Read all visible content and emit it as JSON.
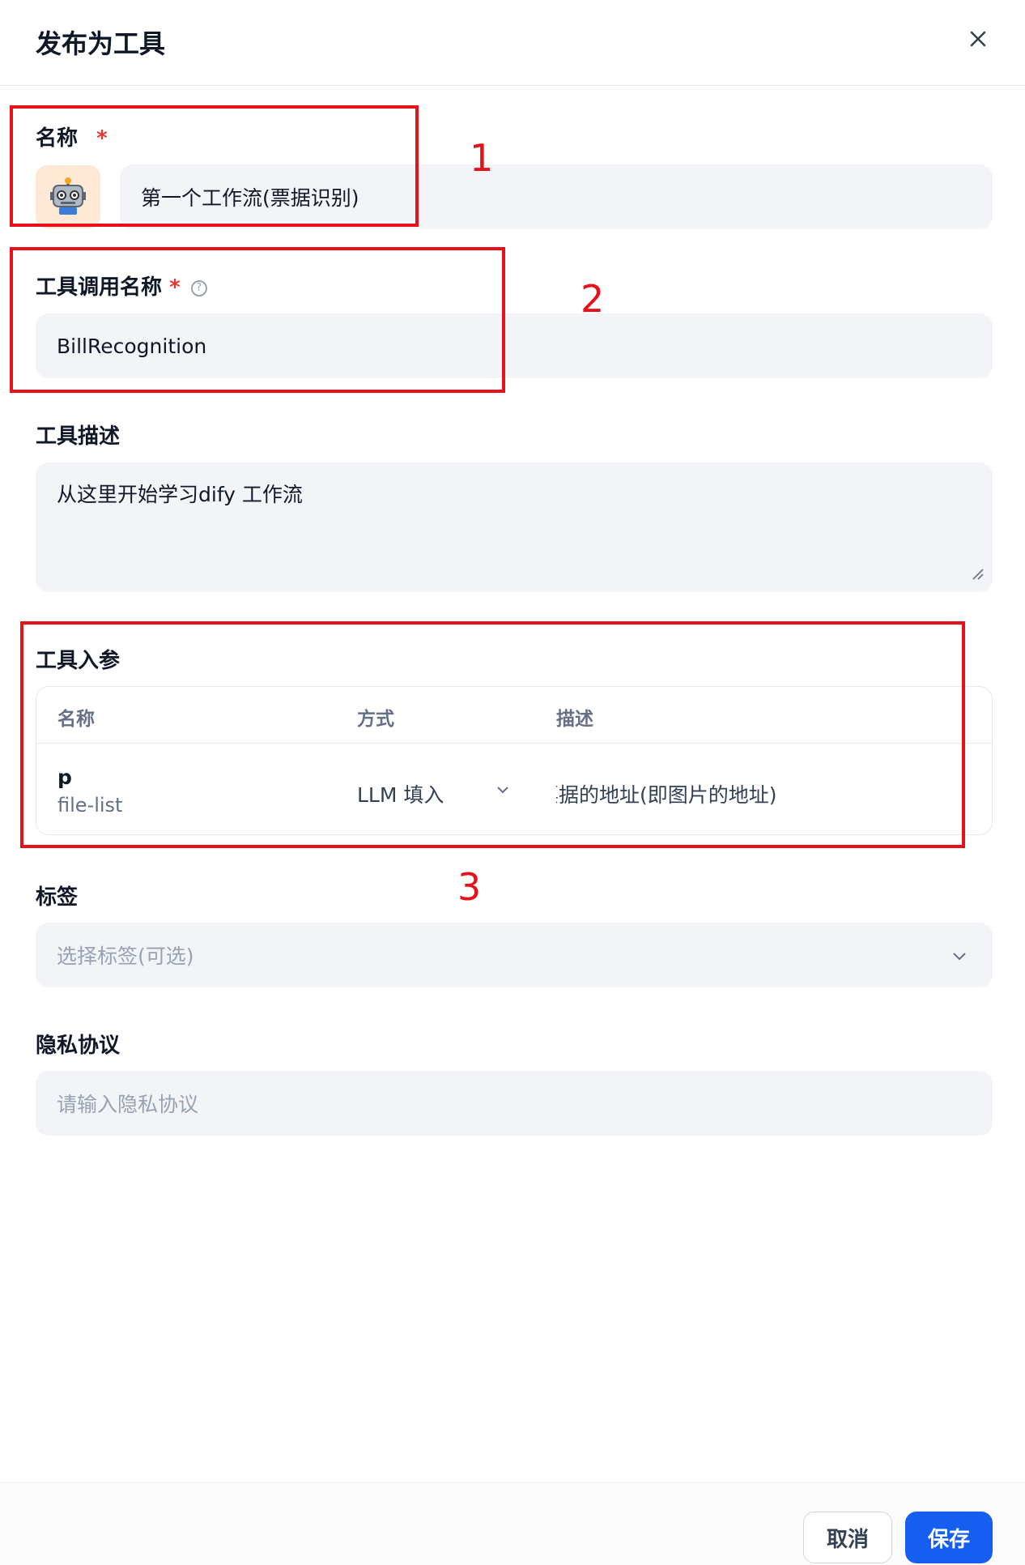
{
  "dialog": {
    "title": "发布为工具"
  },
  "name": {
    "label": "名称",
    "required_mark": "*",
    "icon": "robot-emoji",
    "value": "第一个工作流(票据识别)"
  },
  "tool_call_name": {
    "label": "工具调用名称",
    "required_mark": "*",
    "help_icon": "question-circle-icon",
    "value": "BillRecognition"
  },
  "tool_description": {
    "label": "工具描述",
    "value": "从这里开始学习dify 工作流"
  },
  "tool_params": {
    "label": "工具入参",
    "headers": [
      "名称",
      "方式",
      "描述"
    ],
    "rows": [
      {
        "name": "p",
        "type": "file-list",
        "method": "LLM 填入",
        "description": "票据的地址(即图片的地址)"
      }
    ]
  },
  "tags": {
    "label": "标签",
    "placeholder": "选择标签(可选)"
  },
  "privacy": {
    "label": "隐私协议",
    "placeholder": "请输入隐私协议"
  },
  "footer": {
    "cancel_label": "取消",
    "save_label": "保存"
  },
  "annotations": [
    "1",
    "2",
    "3"
  ],
  "colors": {
    "primary": "#155eef",
    "required": "#e5382e",
    "annotation": "#e8101a",
    "field_bg": "#f2f4f7"
  }
}
